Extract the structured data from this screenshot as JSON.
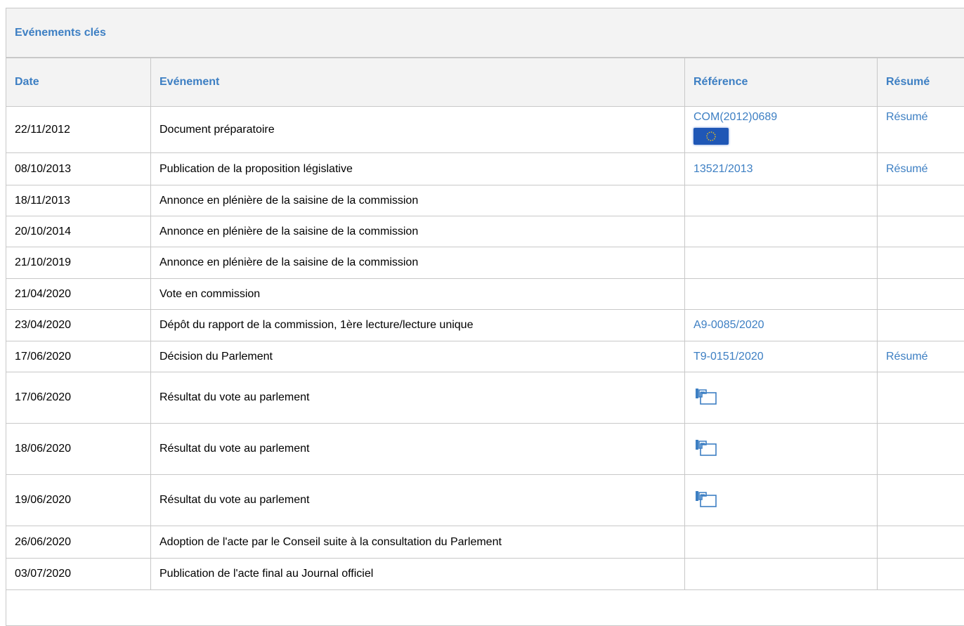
{
  "panel": {
    "title": "Evénements clés"
  },
  "table": {
    "headers": {
      "date": "Date",
      "event": "Evénement",
      "reference": "Référence",
      "summary": "Résumé"
    },
    "rows": [
      {
        "date": "22/11/2012",
        "event": "Document préparatoire",
        "reference": "COM(2012)0689",
        "reference_icon": "eu-flag-icon",
        "summary": "Résumé"
      },
      {
        "date": "08/10/2013",
        "event": "Publication de la proposition législative",
        "reference": "13521/2013",
        "summary": "Résumé"
      },
      {
        "date": "18/11/2013",
        "event": "Annonce en plénière de la saisine de la commission",
        "reference": "",
        "summary": ""
      },
      {
        "date": "20/10/2014",
        "event": "Annonce en plénière de la saisine de la commission",
        "reference": "",
        "summary": ""
      },
      {
        "date": "21/10/2019",
        "event": "Annonce en plénière de la saisine de la commission",
        "reference": "",
        "summary": ""
      },
      {
        "date": "21/04/2020",
        "event": "Vote en commission",
        "reference": "",
        "summary": ""
      },
      {
        "date": "23/04/2020",
        "event": "Dépôt du rapport de la commission, 1ère lecture/lecture unique",
        "reference": "A9-0085/2020",
        "summary": ""
      },
      {
        "date": "17/06/2020",
        "event": "Décision du Parlement",
        "reference": "T9-0151/2020",
        "summary": "Résumé"
      },
      {
        "date": "17/06/2020",
        "event": "Résultat du vote au parlement",
        "reference": "",
        "reference_icon": "vote-result-icon",
        "summary": ""
      },
      {
        "date": "18/06/2020",
        "event": "Résultat du vote au parlement",
        "reference": "",
        "reference_icon": "vote-result-icon",
        "summary": ""
      },
      {
        "date": "19/06/2020",
        "event": "Résultat du vote au parlement",
        "reference": "",
        "reference_icon": "vote-result-icon",
        "summary": ""
      },
      {
        "date": "26/06/2020",
        "event": "Adoption de l'acte par le Conseil suite à la consultation du Parlement",
        "reference": "",
        "summary": ""
      },
      {
        "date": "03/07/2020",
        "event": "Publication de l'acte final au Journal officiel",
        "reference": "",
        "summary": ""
      }
    ]
  },
  "colors": {
    "accent": "#3d7fc3",
    "header_bg": "#f3f3f3",
    "border": "#c8c8c8"
  }
}
